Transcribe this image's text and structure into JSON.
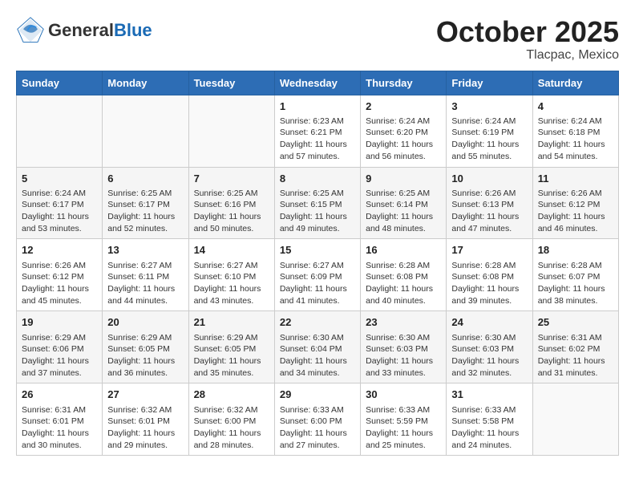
{
  "header": {
    "logo_general": "General",
    "logo_blue": "Blue",
    "month": "October 2025",
    "location": "Tlacpac, Mexico"
  },
  "days_of_week": [
    "Sunday",
    "Monday",
    "Tuesday",
    "Wednesday",
    "Thursday",
    "Friday",
    "Saturday"
  ],
  "weeks": [
    [
      {
        "day": "",
        "info": ""
      },
      {
        "day": "",
        "info": ""
      },
      {
        "day": "",
        "info": ""
      },
      {
        "day": "1",
        "info": "Sunrise: 6:23 AM\nSunset: 6:21 PM\nDaylight: 11 hours and 57 minutes."
      },
      {
        "day": "2",
        "info": "Sunrise: 6:24 AM\nSunset: 6:20 PM\nDaylight: 11 hours and 56 minutes."
      },
      {
        "day": "3",
        "info": "Sunrise: 6:24 AM\nSunset: 6:19 PM\nDaylight: 11 hours and 55 minutes."
      },
      {
        "day": "4",
        "info": "Sunrise: 6:24 AM\nSunset: 6:18 PM\nDaylight: 11 hours and 54 minutes."
      }
    ],
    [
      {
        "day": "5",
        "info": "Sunrise: 6:24 AM\nSunset: 6:17 PM\nDaylight: 11 hours and 53 minutes."
      },
      {
        "day": "6",
        "info": "Sunrise: 6:25 AM\nSunset: 6:17 PM\nDaylight: 11 hours and 52 minutes."
      },
      {
        "day": "7",
        "info": "Sunrise: 6:25 AM\nSunset: 6:16 PM\nDaylight: 11 hours and 50 minutes."
      },
      {
        "day": "8",
        "info": "Sunrise: 6:25 AM\nSunset: 6:15 PM\nDaylight: 11 hours and 49 minutes."
      },
      {
        "day": "9",
        "info": "Sunrise: 6:25 AM\nSunset: 6:14 PM\nDaylight: 11 hours and 48 minutes."
      },
      {
        "day": "10",
        "info": "Sunrise: 6:26 AM\nSunset: 6:13 PM\nDaylight: 11 hours and 47 minutes."
      },
      {
        "day": "11",
        "info": "Sunrise: 6:26 AM\nSunset: 6:12 PM\nDaylight: 11 hours and 46 minutes."
      }
    ],
    [
      {
        "day": "12",
        "info": "Sunrise: 6:26 AM\nSunset: 6:12 PM\nDaylight: 11 hours and 45 minutes."
      },
      {
        "day": "13",
        "info": "Sunrise: 6:27 AM\nSunset: 6:11 PM\nDaylight: 11 hours and 44 minutes."
      },
      {
        "day": "14",
        "info": "Sunrise: 6:27 AM\nSunset: 6:10 PM\nDaylight: 11 hours and 43 minutes."
      },
      {
        "day": "15",
        "info": "Sunrise: 6:27 AM\nSunset: 6:09 PM\nDaylight: 11 hours and 41 minutes."
      },
      {
        "day": "16",
        "info": "Sunrise: 6:28 AM\nSunset: 6:08 PM\nDaylight: 11 hours and 40 minutes."
      },
      {
        "day": "17",
        "info": "Sunrise: 6:28 AM\nSunset: 6:08 PM\nDaylight: 11 hours and 39 minutes."
      },
      {
        "day": "18",
        "info": "Sunrise: 6:28 AM\nSunset: 6:07 PM\nDaylight: 11 hours and 38 minutes."
      }
    ],
    [
      {
        "day": "19",
        "info": "Sunrise: 6:29 AM\nSunset: 6:06 PM\nDaylight: 11 hours and 37 minutes."
      },
      {
        "day": "20",
        "info": "Sunrise: 6:29 AM\nSunset: 6:05 PM\nDaylight: 11 hours and 36 minutes."
      },
      {
        "day": "21",
        "info": "Sunrise: 6:29 AM\nSunset: 6:05 PM\nDaylight: 11 hours and 35 minutes."
      },
      {
        "day": "22",
        "info": "Sunrise: 6:30 AM\nSunset: 6:04 PM\nDaylight: 11 hours and 34 minutes."
      },
      {
        "day": "23",
        "info": "Sunrise: 6:30 AM\nSunset: 6:03 PM\nDaylight: 11 hours and 33 minutes."
      },
      {
        "day": "24",
        "info": "Sunrise: 6:30 AM\nSunset: 6:03 PM\nDaylight: 11 hours and 32 minutes."
      },
      {
        "day": "25",
        "info": "Sunrise: 6:31 AM\nSunset: 6:02 PM\nDaylight: 11 hours and 31 minutes."
      }
    ],
    [
      {
        "day": "26",
        "info": "Sunrise: 6:31 AM\nSunset: 6:01 PM\nDaylight: 11 hours and 30 minutes."
      },
      {
        "day": "27",
        "info": "Sunrise: 6:32 AM\nSunset: 6:01 PM\nDaylight: 11 hours and 29 minutes."
      },
      {
        "day": "28",
        "info": "Sunrise: 6:32 AM\nSunset: 6:00 PM\nDaylight: 11 hours and 28 minutes."
      },
      {
        "day": "29",
        "info": "Sunrise: 6:33 AM\nSunset: 6:00 PM\nDaylight: 11 hours and 27 minutes."
      },
      {
        "day": "30",
        "info": "Sunrise: 6:33 AM\nSunset: 5:59 PM\nDaylight: 11 hours and 25 minutes."
      },
      {
        "day": "31",
        "info": "Sunrise: 6:33 AM\nSunset: 5:58 PM\nDaylight: 11 hours and 24 minutes."
      },
      {
        "day": "",
        "info": ""
      }
    ]
  ]
}
